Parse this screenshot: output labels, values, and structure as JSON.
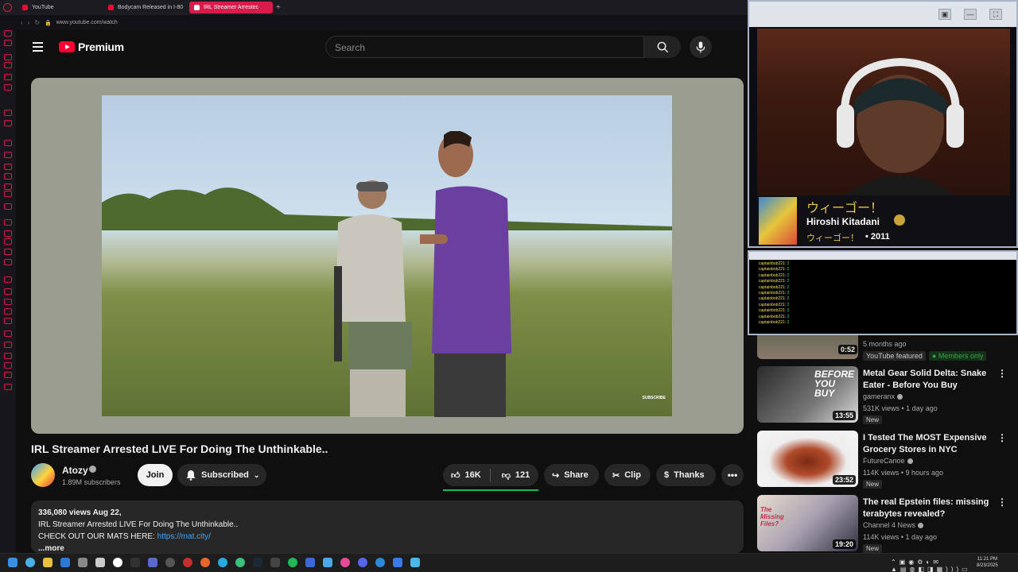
{
  "browser": {
    "tabs": [
      {
        "label": "YouTube",
        "active": false,
        "muted": false
      },
      {
        "label": "Bodycam Released in I-80",
        "active": false,
        "muted": false
      },
      {
        "label": "IRL Streamer Arrestec",
        "active": true,
        "muted": true
      }
    ],
    "new_tab": "+",
    "url": "www.youtube.com/watch"
  },
  "header": {
    "logo_text": "Premium",
    "search_placeholder": "Search"
  },
  "video": {
    "title": "IRL Streamer Arrested LIVE For Doing The Unthinkable..",
    "watermark": "SUBSCRIBE",
    "channel": "Atozy",
    "subscribers": "1.89M subscribers",
    "join_label": "Join",
    "subscribed_label": "Subscribed",
    "likes": "16K",
    "dislikes": "121",
    "share_label": "Share",
    "clip_label": "Clip",
    "thanks_label": "Thanks",
    "more_label": "•••"
  },
  "description": {
    "views_date": "336,080 views  Aug 22,",
    "line1": "IRL Streamer Arrested LIVE For Doing The Unthinkable..",
    "line2_prefix": "CHECK OUT OUR MATS HERE: ",
    "line2_link": "https://mat.city/",
    "more": "...more"
  },
  "camera_overlay": {
    "jp_line1": "ウィーゴー！",
    "artist": "Hiroshi Kitadani",
    "jp_line2": "ウィーゴー！",
    "year": "• 2011"
  },
  "chat": {
    "lines": [
      {
        "user": "captainbob221:",
        "msg": "2"
      },
      {
        "user": "captainbob221:",
        "msg": "2"
      },
      {
        "user": "captainbob221:",
        "msg": "2"
      },
      {
        "user": "captainbob221:",
        "msg": "2"
      },
      {
        "user": "captainbob221:",
        "msg": "2"
      },
      {
        "user": "captainbob221:",
        "msg": "2"
      },
      {
        "user": "captainbob221:",
        "msg": "2"
      },
      {
        "user": "captainbob221:",
        "msg": "2"
      },
      {
        "user": "captainbob221:",
        "msg": "2"
      },
      {
        "user": "captainbob221:",
        "msg": "2"
      },
      {
        "user": "captainbob221:",
        "msg": "2"
      }
    ]
  },
  "recommendations": {
    "partial": {
      "duration": "0:52",
      "date": "5 months ago",
      "featured": "YouTube featured",
      "members": "● Members only"
    },
    "items": [
      {
        "title": "Metal Gear Solid Delta: Snake Eater - Before You Buy",
        "channel": "gameranx",
        "meta": "531K views • 1 day ago",
        "badge": "New",
        "duration": "13:55",
        "thumb_text": "BEFORE YOU BUY"
      },
      {
        "title": "I Tested The MOST Expensive Grocery Stores in NYC",
        "channel": "FutureCanoe",
        "meta": "114K views • 9 hours ago",
        "badge": "New",
        "duration": "23:52",
        "thumb_text": ""
      },
      {
        "title": "The real Epstein files: missing terabytes revealed?",
        "channel": "Channel 4 News",
        "meta": "114K views • 1 day ago",
        "badge": "New",
        "duration": "19:20",
        "thumb_text": "The Missing Files?"
      }
    ]
  },
  "taskbar": {
    "clock_time": "11:21 PM",
    "clock_date": "8/23/2025"
  },
  "colors": {
    "accent": "#ff0033",
    "browser_accent": "#d81b4a",
    "like_underline": "#1db954",
    "link": "#3ea6ff"
  }
}
